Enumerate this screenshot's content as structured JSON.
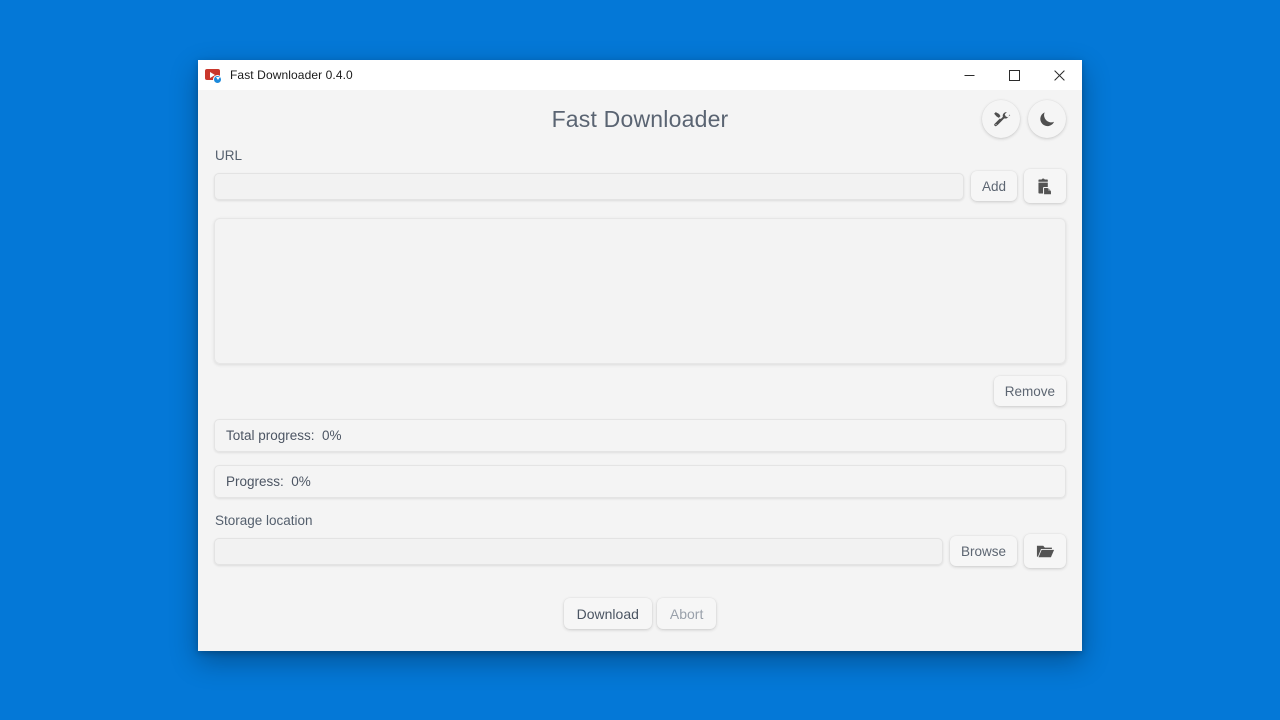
{
  "desktop": {
    "background_color": "#0478d7"
  },
  "window": {
    "title": "Fast Downloader 0.4.0",
    "icon": "video-download-icon",
    "controls": {
      "minimize": "minimize-icon",
      "maximize": "maximize-icon",
      "close": "close-icon"
    }
  },
  "header": {
    "app_title": "Fast Downloader",
    "tools_button_icon": "tools-icon",
    "theme_button_icon": "moon-icon"
  },
  "url_section": {
    "label": "URL",
    "input_value": "",
    "input_placeholder": "",
    "add_label": "Add",
    "paste_button_icon": "clipboard-paste-icon"
  },
  "download_list": {
    "items": [],
    "remove_label": "Remove"
  },
  "progress": {
    "total": {
      "label": "Total progress:  0%",
      "percent": 0
    },
    "current": {
      "label": "Progress:  0%",
      "percent": 0
    },
    "fill_color": "#cfe6fa"
  },
  "storage": {
    "label": "Storage location",
    "input_value": "",
    "input_placeholder": "",
    "browse_label": "Browse",
    "folder_button_icon": "open-folder-icon"
  },
  "actions": {
    "download_label": "Download",
    "abort_label": "Abort"
  }
}
